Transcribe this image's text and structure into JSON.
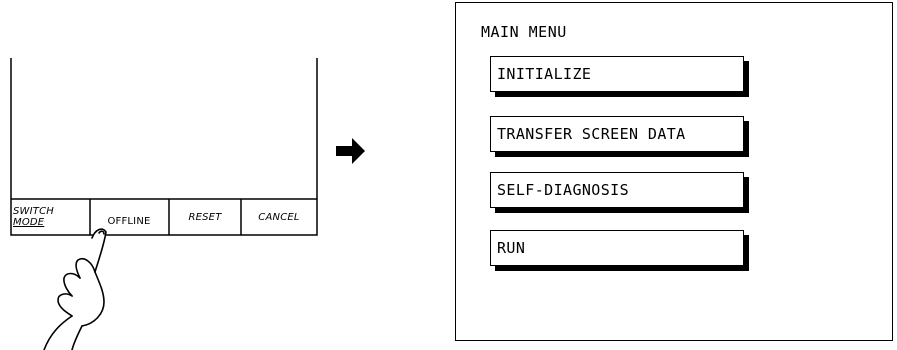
{
  "device": {
    "buttons": {
      "switch_mode_line1": "SWITCH",
      "switch_mode_line2": "MODE",
      "offline": "OFFLINE",
      "reset": "RESET",
      "cancel": "CANCEL"
    }
  },
  "arrow": {
    "icon": "right-arrow-icon"
  },
  "main_menu": {
    "title": "MAIN MENU",
    "items": [
      {
        "label": "INITIALIZE"
      },
      {
        "label": "TRANSFER SCREEN DATA"
      },
      {
        "label": "SELF-DIAGNOSIS"
      },
      {
        "label": "RUN"
      }
    ]
  }
}
